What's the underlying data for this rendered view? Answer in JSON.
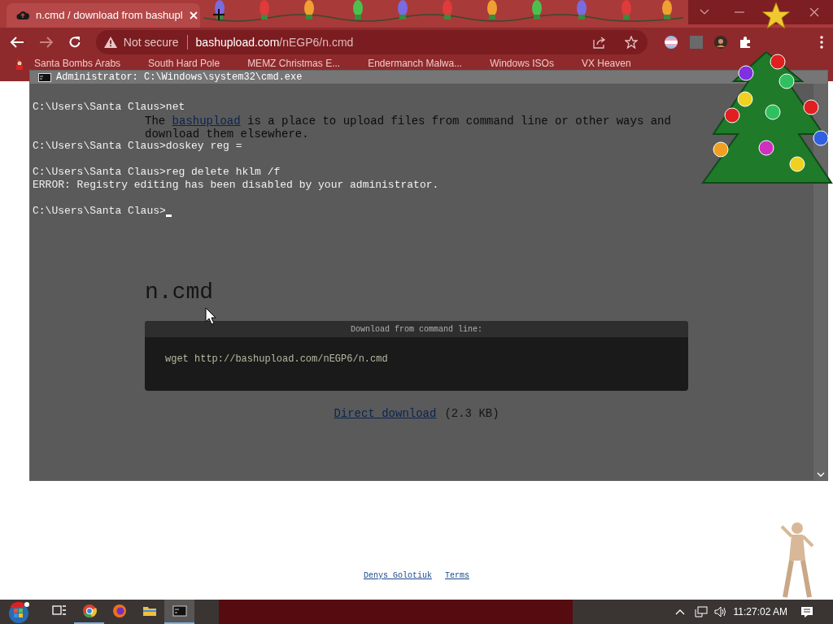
{
  "browser": {
    "tab": {
      "title": "n.cmd / download from bashupl"
    },
    "address_bar": {
      "security": "Not secure",
      "host": "bashupload.com",
      "path": "/nEGP6/n.cmd"
    },
    "bookmarks": [
      "Santa Bombs Arabs",
      "South Hard Pole",
      "MEMZ Christmas E...",
      "Endermanch Malwa...",
      "Windows ISOs",
      "VX Heaven"
    ]
  },
  "page": {
    "intro": {
      "before": "The ",
      "link": "bashupload",
      "after": " is a place to upload files from command line or other ways and download them elsewhere."
    },
    "file_name": "n.cmd",
    "command_box": {
      "header": "Download from command line:",
      "command": "wget http://bashupload.com/nEGP6/n.cmd"
    },
    "download": {
      "link": "Direct download",
      "size": "(2.3 KB)"
    },
    "footer_links": [
      "Denys Golotiuk",
      "Terms"
    ]
  },
  "console": {
    "title": "Administrator: C:\\Windows\\system32\\cmd.exe",
    "cursor": true,
    "blocks": [
      [
        "C:\\Users\\Santa Claus>net"
      ],
      [
        "C:\\Users\\Santa Claus>doskey reg ="
      ],
      [
        "C:\\Users\\Santa Claus>reg delete hklm /f",
        "ERROR: Registry editing has been disabled by your administrator."
      ],
      [
        "C:\\Users\\Santa Claus>"
      ]
    ]
  },
  "taskbar": {
    "apps": [
      {
        "kind": "taskview",
        "selected": false
      },
      {
        "kind": "chrome",
        "selected": false
      },
      {
        "kind": "firefox",
        "selected": false
      },
      {
        "kind": "explorer",
        "selected": false
      },
      {
        "kind": "cmd",
        "selected": true
      }
    ],
    "clock": "11:27:02 AM"
  }
}
